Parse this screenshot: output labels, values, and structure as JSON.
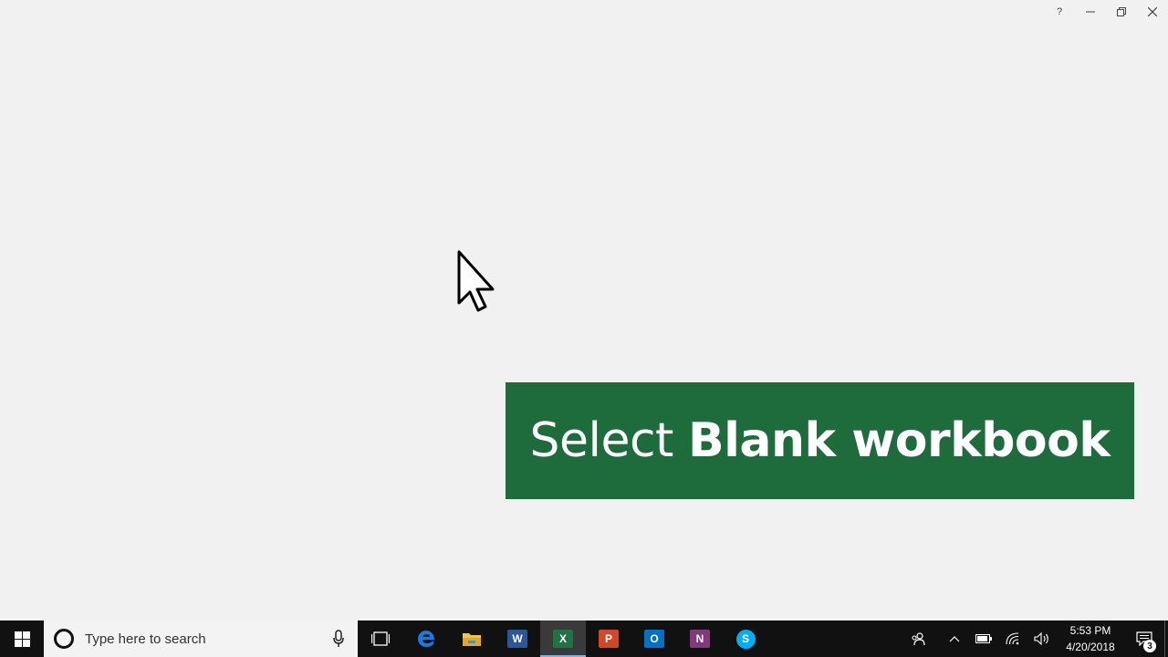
{
  "window": {
    "caption_buttons": [
      {
        "name": "help-button",
        "icon": "help-icon",
        "glyph": "?"
      },
      {
        "name": "minimize-button",
        "icon": "minimize-icon"
      },
      {
        "name": "restore-button",
        "icon": "restore-icon"
      },
      {
        "name": "close-button",
        "icon": "close-icon"
      }
    ]
  },
  "callout": {
    "prefix": "Select",
    "emphasis": "Blank workbook",
    "background": "#1e6b3c"
  },
  "taskbar": {
    "search_placeholder": "Type here to search",
    "apps": [
      {
        "name": "task-view",
        "icon": "task-view-icon"
      },
      {
        "name": "edge",
        "icon": "edge-icon",
        "color": "#1e78d6"
      },
      {
        "name": "file-explorer",
        "icon": "folder-icon",
        "color": "#f3c44a"
      },
      {
        "name": "word",
        "icon": "word-icon",
        "letter": "W",
        "color": "#2b579a"
      },
      {
        "name": "excel",
        "icon": "excel-icon",
        "letter": "X",
        "color": "#217346",
        "active": true
      },
      {
        "name": "powerpoint",
        "icon": "powerpoint-icon",
        "letter": "P",
        "color": "#d24726"
      },
      {
        "name": "outlook",
        "icon": "outlook-icon",
        "letter": "O",
        "color": "#0072c6"
      },
      {
        "name": "onenote",
        "icon": "onenote-icon",
        "letter": "N",
        "color": "#80397b"
      },
      {
        "name": "skype",
        "icon": "skype-icon",
        "letter": "S",
        "color": "#00aff0"
      }
    ],
    "clock": {
      "time": "5:53 PM",
      "date": "4/20/2018"
    },
    "notification_count": "3"
  }
}
